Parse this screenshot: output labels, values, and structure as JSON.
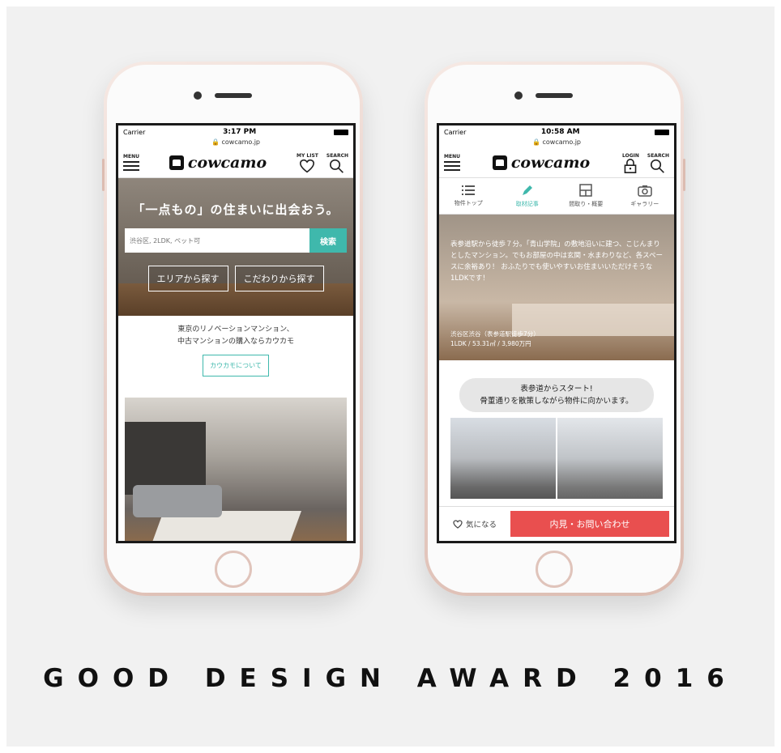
{
  "award": {
    "text": "GOOD DESIGN AWARD 2016"
  },
  "phone_left": {
    "status": {
      "carrier": "Carrier",
      "time": "3:17 PM"
    },
    "url": "cowcamo.jp",
    "nav": {
      "menu_label": "MENU",
      "logo": "cowcamo",
      "mylist_label": "MY LIST",
      "search_label": "SEARCH"
    },
    "hero": {
      "tagline": "「一点もの」の住まいに出会おう。",
      "search_placeholder": "渋谷区, 2LDK, ペット可",
      "search_button": "検索",
      "area_button": "エリアから探す",
      "kodawari_button": "こだわりから探す"
    },
    "intro": {
      "line1": "東京のリノベーションマンション、",
      "line2": "中古マンションの購入ならカウカモ"
    },
    "about_button": "カウカモについて"
  },
  "phone_right": {
    "status": {
      "carrier": "Carrier",
      "time": "10:58 AM"
    },
    "url": "cowcamo.jp",
    "nav": {
      "menu_label": "MENU",
      "logo": "cowcamo",
      "login_label": "LOGIN",
      "search_label": "SEARCH"
    },
    "tabs": [
      {
        "label": "物件トップ",
        "icon": "list-icon"
      },
      {
        "label": "取材記事",
        "icon": "pen-icon"
      },
      {
        "label": "間取り・概要",
        "icon": "floorplan-icon"
      },
      {
        "label": "ギャラリー",
        "icon": "camera-icon"
      }
    ],
    "active_tab": "取材記事",
    "article": {
      "text": "表参道駅から徒歩７分。「青山学院」の敷地沿いに建つ、こじんまりとしたマンション。でもお部屋の中は玄関・水まわりなど、各スペースに余裕あり！ おふたりでも使いやすいお住まいいただけそうな1LDKです！",
      "location": "渋谷区渋谷（表参道駅徒歩7分）",
      "specs": "1LDK / 53.31㎡ / 3,980万円"
    },
    "bubble": {
      "line1": "表参道からスタート!",
      "line2": "骨董通りを散策しながら物件に向かいます。"
    },
    "footer": {
      "fav_label": "気になる",
      "contact_button": "内見・お問い合わせ"
    }
  },
  "colors": {
    "accent": "#3fb8ac",
    "cta": "#e94f4f",
    "phone_body": "#e8cfc7"
  }
}
